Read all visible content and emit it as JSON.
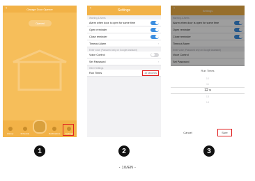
{
  "phone1": {
    "title": "Garage Door Opener",
    "pill_label": "Opened",
    "nav": [
      "History",
      "Schedule",
      "",
      "Notifications",
      "Settings"
    ]
  },
  "phone2": {
    "title": "Settings",
    "sections": {
      "warning": "Warning & Alerts",
      "voice": "Enter voice (Password only on Google Assistant)",
      "other": "Other Settings"
    },
    "rows": {
      "alarm": "Alarm when door is open for some time",
      "open": "Open reminder",
      "close": "Close reminder",
      "timeout": "Timeout Alarm",
      "voice": "Voice Control",
      "password": "Set Password",
      "run": "Run Times"
    },
    "run_value": "15 seconds",
    "toggles": {
      "alarm": true,
      "open": true,
      "close": true,
      "voice": false
    }
  },
  "phone3": {
    "title": "Settings",
    "sections": {
      "warning": "Warning & Alerts",
      "voice": "Enter voice (Password only on Google Assistant)",
      "other": "Other Settings"
    },
    "rows": {
      "alarm": "Alarm when door is open for some time",
      "open": "Open reminder",
      "close": "Close reminder",
      "timeout": "Timeout Alarm",
      "voice": "Voice Control",
      "password": "Set Password",
      "run": "Run Times"
    },
    "sheet_title": "Run Times",
    "picker": {
      "before2": "10",
      "before1": "11",
      "selected": "12",
      "unit": "s",
      "after1": "13",
      "after2": "14"
    },
    "cancel": "Cancel",
    "sure": "Sure"
  },
  "steps": [
    "1",
    "2",
    "3"
  ],
  "footer": "- 10/EN -",
  "colors": {
    "accent": "#f2b247",
    "toggle_on": "#3d8fe0",
    "highlight": "#e02020"
  }
}
